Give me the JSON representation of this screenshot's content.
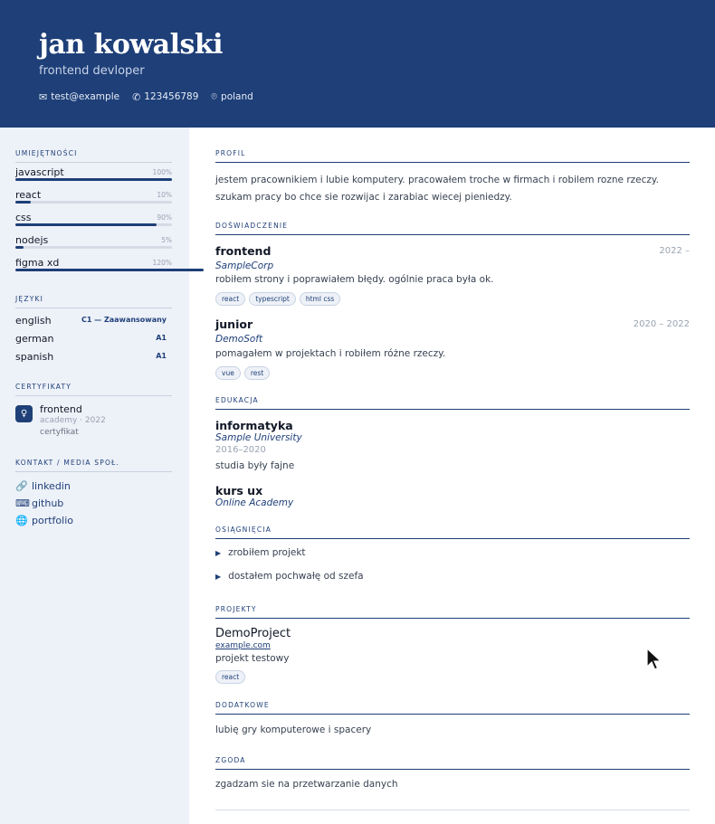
{
  "header": {
    "name": "jan kowalski",
    "role": "frontend devloper",
    "contacts": [
      {
        "icon": "mail-icon",
        "text": "test@example"
      },
      {
        "icon": "phone-icon",
        "text": "123456789"
      },
      {
        "icon": "location-pin-icon",
        "text": "poland"
      }
    ]
  },
  "sidebar": {
    "skills_title": "UMIEJĘTNOŚCI",
    "skills": [
      {
        "name": "javascript",
        "percent_label": "100%",
        "level": 1.0
      },
      {
        "name": "react",
        "percent_label": "10%",
        "level": 0.1
      },
      {
        "name": "css",
        "percent_label": "90%",
        "level": 0.9
      },
      {
        "name": "nodejs",
        "percent_label": "5%",
        "level": 0.05
      },
      {
        "name": "figma xd",
        "percent_label": "120%",
        "level": 1.2
      }
    ],
    "languages_title": "JĘZYKI",
    "languages": [
      {
        "name": "english",
        "level": "C1 — Zaawansowany"
      },
      {
        "name": "german",
        "level": "A1"
      },
      {
        "name": "spanish",
        "level": "A1"
      }
    ],
    "certs_title": "CERTYFIKATY",
    "certs": [
      {
        "title": "frontend",
        "sub": "academy · 2022",
        "desc": "certyfikat"
      }
    ],
    "contact_title": "KONTAKT / MEDIA SPOŁ.",
    "links": [
      {
        "icon": "link-icon",
        "glyph": "🔗",
        "label": "linkedin"
      },
      {
        "icon": "keyboard-icon",
        "glyph": "⌨",
        "label": "github"
      },
      {
        "icon": "globe-icon",
        "glyph": "🌐",
        "label": "portfolio"
      }
    ]
  },
  "main": {
    "profile_title": "PROFIL",
    "profile_text": "jestem pracownikiem i lubie komputery. pracowałem troche w firmach i robilem rozne rzeczy. szukam pracy bo chce sie rozwijac i zarabiac wiecej pieniedzy.",
    "experience_title": "DOŚWIADCZENIE",
    "jobs": [
      {
        "title": "frontend",
        "date": "2022 –",
        "company": "SampleCorp",
        "desc": "robiłem strony i poprawiałem błędy. ogólnie praca była ok.",
        "tags": [
          "react",
          "typescript",
          "html css"
        ]
      },
      {
        "title": "junior",
        "date": "2020 – 2022",
        "company": "DemoSoft",
        "desc": "pomagałem w projektach i robiłem różne rzeczy.",
        "tags": [
          "vue",
          "rest"
        ]
      }
    ],
    "education_title": "EDUKACJA",
    "education": [
      {
        "title": "informatyka",
        "school": "Sample University",
        "years": "2016–2020",
        "desc": "studia były fajne"
      },
      {
        "title": "kurs ux",
        "school": "Online Academy"
      }
    ],
    "achievements_title": "OSIĄGNIĘCIA",
    "achievements": [
      "zrobiłem projekt",
      "dostałem pochwałę od szefa"
    ],
    "projects_title": "PROJEKTY",
    "projects": [
      {
        "name": "DemoProject",
        "link": "example.com",
        "desc": "projekt testowy",
        "tags": [
          "react"
        ]
      }
    ],
    "additional_title": "DODATKOWE",
    "additional_text": "lubię gry komputerowe i spacery",
    "consent_title": "ZGODA",
    "consent_text": "zgadzam sie na przetwarzanie danych"
  },
  "colors": {
    "accent": "#1e3f78",
    "sidebar_bg": "#edf1f8"
  }
}
